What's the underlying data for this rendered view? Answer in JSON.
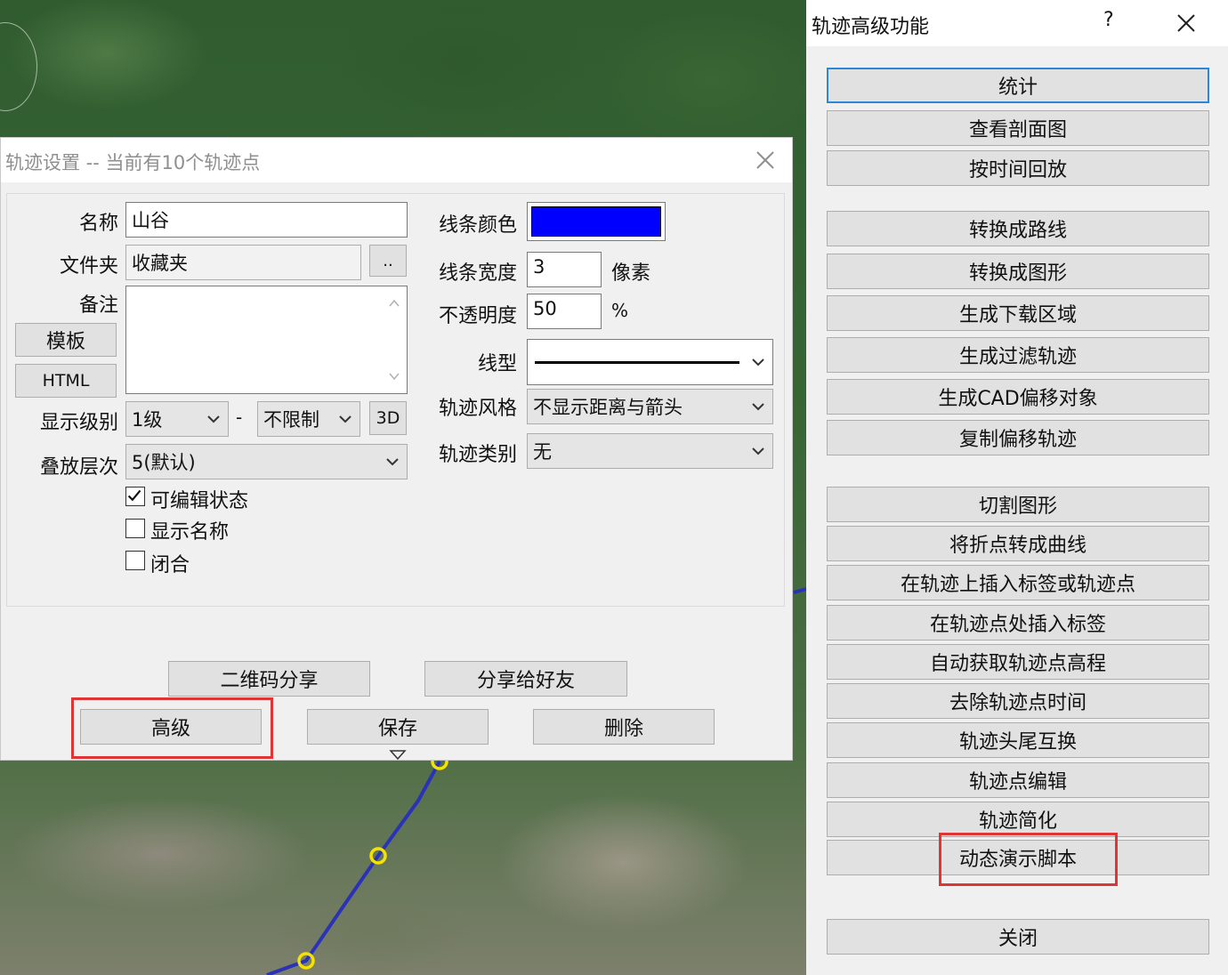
{
  "track_dialog": {
    "title": "轨迹设置 -- 当前有10个轨迹点",
    "name_label": "名称",
    "name_value": "山谷",
    "folder_label": "文件夹",
    "folder_value": "收藏夹",
    "browse_label": "..",
    "note_label": "备注",
    "template_button": "模板",
    "html_button": "HTML",
    "display_level_label": "显示级别",
    "level_min": "1级",
    "level_sep": "-",
    "level_max": "不限制",
    "btn_3d": "3D",
    "layer_label": "叠放层次",
    "layer_value": "5(默认)",
    "editable_label": "可编辑状态",
    "editable_checked": true,
    "show_name_label": "显示名称",
    "show_name_checked": false,
    "closed_label": "闭合",
    "closed_checked": false,
    "line_color_label": "线条颜色",
    "line_color": "#0000ff",
    "line_width_label": "线条宽度",
    "line_width_value": "3",
    "line_width_unit": "像素",
    "opacity_label": "不透明度",
    "opacity_value": "50",
    "opacity_unit": "%",
    "line_type_label": "线型",
    "track_style_label": "轨迹风格",
    "track_style_value": "不显示距离与箭头",
    "track_type_label": "轨迹类别",
    "track_type_value": "无",
    "qr_share_button": "二维码分享",
    "share_friend_button": "分享给好友",
    "advanced_button": "高级",
    "save_button": "保存",
    "delete_button": "删除"
  },
  "adv_panel": {
    "title": "轨迹高级功能",
    "help": "?",
    "buttons": [
      "统计",
      "查看剖面图",
      "按时间回放",
      "转换成路线",
      "转换成图形",
      "生成下载区域",
      "生成过滤轨迹",
      "生成CAD偏移对象",
      "复制偏移轨迹",
      "切割图形",
      "将折点转成曲线",
      "在轨迹上插入标签或轨迹点",
      "在轨迹点处插入标签",
      "自动获取轨迹点高程",
      "去除轨迹点时间",
      "轨迹头尾互换",
      "轨迹点编辑",
      "轨迹简化",
      "动态演示脚本",
      "关闭"
    ]
  },
  "colors": {
    "highlight_box": "#e03535",
    "track_line": "#2a32b8",
    "track_point": "#f5e200",
    "focus_border": "#2b88d9"
  }
}
